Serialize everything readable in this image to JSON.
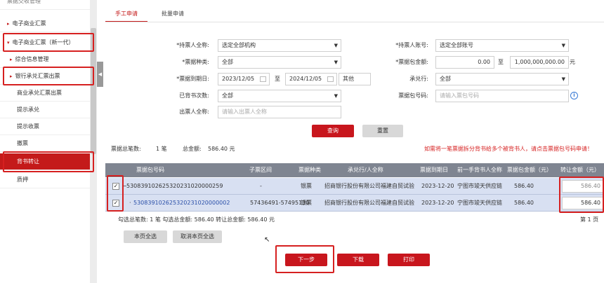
{
  "sidebar": {
    "items": [
      {
        "label": "票据交收管理"
      },
      {
        "label": "电子商业汇票"
      },
      {
        "label": "电子商业汇票（新一代）"
      },
      {
        "label": "综合信息管理"
      },
      {
        "label": "银行承兑汇票出票"
      },
      {
        "label": "商业承兑汇票出票"
      },
      {
        "label": "提示承兑"
      },
      {
        "label": "提示收票"
      },
      {
        "label": "撤票"
      },
      {
        "label": "背书转让"
      },
      {
        "label": "质押"
      }
    ]
  },
  "tabs": [
    {
      "label": "手工申请"
    },
    {
      "label": "批量申请"
    }
  ],
  "form": {
    "holder_name_label": "*持票人全称:",
    "holder_name_value": "选定全部机构",
    "holder_account_label": "*持票人账号:",
    "holder_account_value": "选定全部账号",
    "bill_type_label": "*票据种类:",
    "bill_type_value": "全部",
    "pkg_amount_label": "*票据包金额:",
    "pkg_amount_from": "0.00",
    "to_label": "至",
    "pkg_amount_to": "1,000,000,000.00",
    "unit": "元",
    "due_date_label": "*票据到期日:",
    "due_date_from": "2023/12/05",
    "due_date_to": "2024/12/05",
    "other_label": "其他",
    "acceptor_label": "承兑行:",
    "acceptor_value": "全部",
    "endorse_count_label": "已背书次数:",
    "endorse_count_value": "全部",
    "pkg_no_label": "票据包号码:",
    "pkg_no_placeholder": "请输入票包号码",
    "drawer_label": "出票人全称:",
    "drawer_placeholder": "请输入出票人全称",
    "query_button": "查询",
    "reset_button": "重置"
  },
  "summary": {
    "total_count_label": "票据总笔数:",
    "total_count_value": "1 笔",
    "total_amount_label": "总金额:",
    "total_amount_value": "586.40 元",
    "notice": "如需将一笔票据拆分背书给多个被背书人，请点击票据包号码申请！"
  },
  "table": {
    "headers": [
      "票据包号码",
      "子票区间",
      "票据种类",
      "承兑行/人全称",
      "票据到期日",
      "前一手背书人全称",
      "票据包金额（元）",
      "转让金额（元）"
    ],
    "rows": [
      {
        "checked": "✓",
        "prefix": "−",
        "pkg_no": "530839102625320231020000259",
        "range": "-",
        "type": "银票",
        "acceptor": "招商银行股份有限公司福建自贸试验",
        "due": "2023-12-20",
        "prev": "宁图市竣天供应链",
        "pkg_amount": "586.40",
        "transfer": "586.40"
      },
      {
        "checked": "✓",
        "prefix": "·",
        "pkg_no": "530839102625320231020000002",
        "range": "57436491-57495130",
        "type": "银票",
        "acceptor": "招商银行股份有限公司福建自贸试验",
        "due": "2023-12-20",
        "prev": "宁图市竣天供应链",
        "pkg_amount": "586.40",
        "transfer": "586.40"
      }
    ]
  },
  "selection": {
    "text": "勾选总笔数: 1 笔 勾选总金额: 586.40 转让总金额: 586.40 元",
    "page": "第 1 页"
  },
  "actions": {
    "select_page": "本页全选",
    "deselect_page": "取消本页全选",
    "next": "下一步",
    "download": "下载",
    "print": "打印"
  },
  "colors": {
    "accent": "#c8161d",
    "row_bg": "#d8e0f2",
    "header_bg": "#7f8591"
  }
}
